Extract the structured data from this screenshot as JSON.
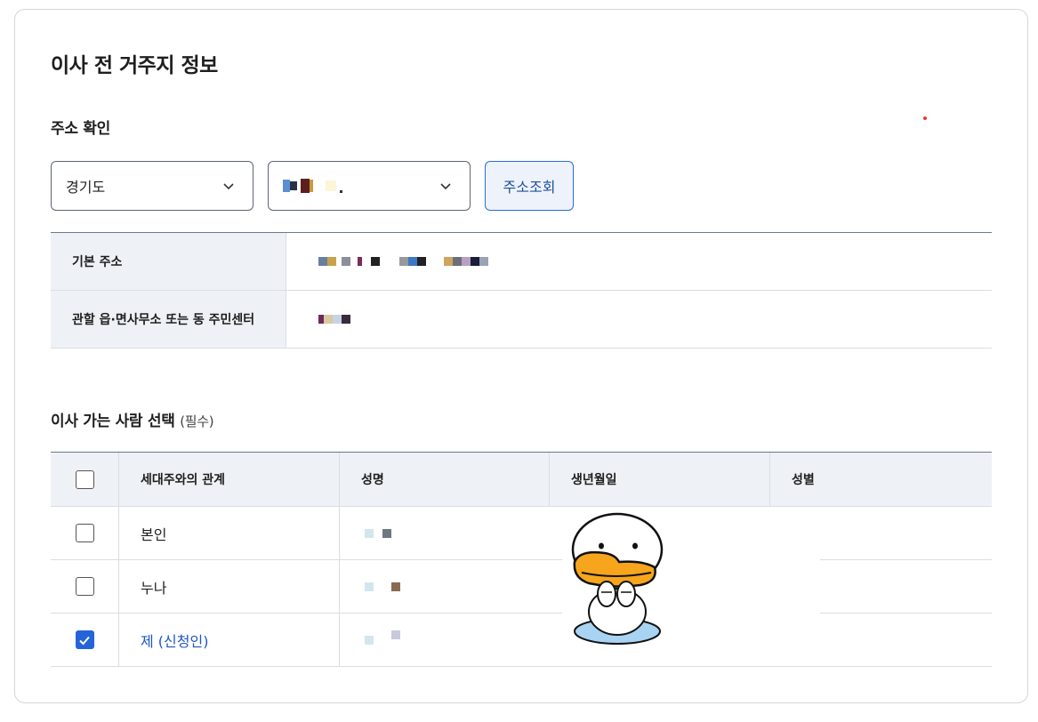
{
  "title": "이사 전 거주지 정보",
  "address_section": {
    "title": "주소 확인",
    "province": "경기도",
    "lookup_button": "주소조회",
    "rows": [
      {
        "label": "기본 주소"
      },
      {
        "label": "관할 읍·면사무소 또는 동 주민센터"
      }
    ]
  },
  "people_section": {
    "title": "이사 가는 사람 선택",
    "required": "(필수)",
    "columns": [
      "세대주와의 관계",
      "성명",
      "생년월일",
      "성별"
    ],
    "rows": [
      {
        "relation": "본인",
        "checked": false
      },
      {
        "relation": "누나",
        "checked": false
      },
      {
        "relation": "제 (신청인)",
        "checked": true
      }
    ]
  },
  "colors": {
    "accent": "#2563d9",
    "link": "#1d56c4",
    "header_bg": "#eef1f5"
  },
  "icons": [
    "chevron-down-icon",
    "checkmark-icon",
    "character-sticker"
  ]
}
